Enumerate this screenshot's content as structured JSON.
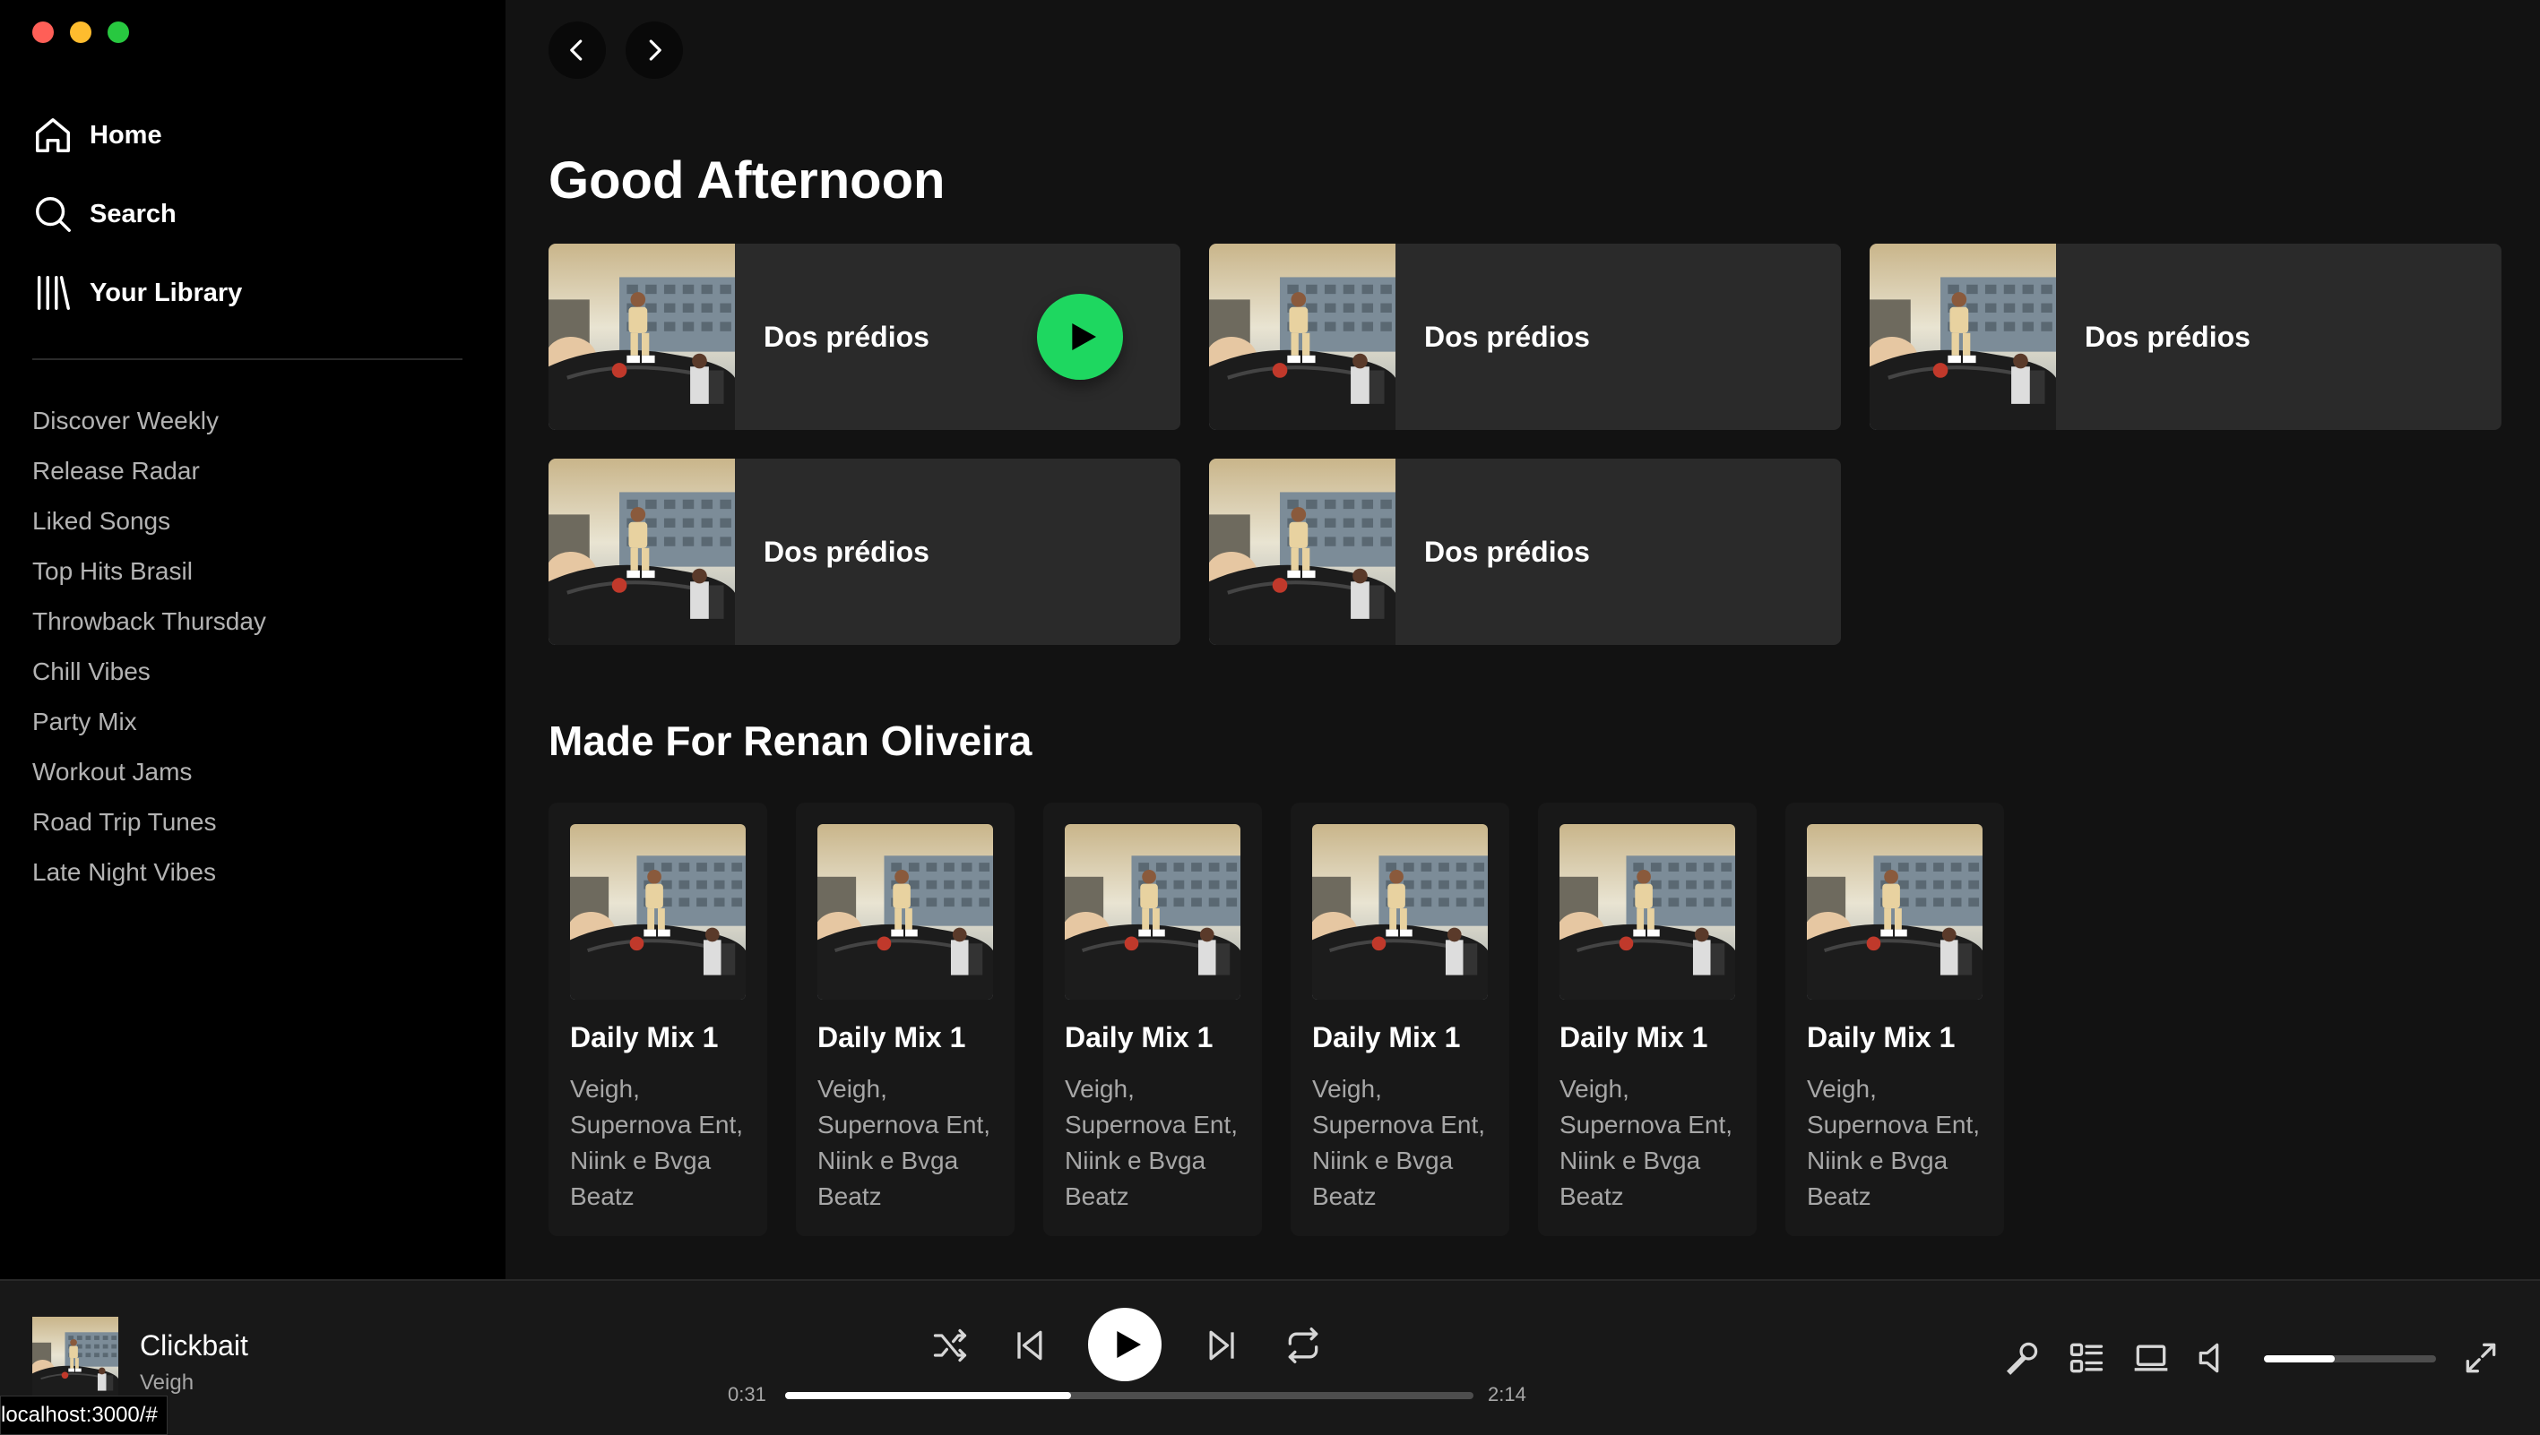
{
  "sidebar": {
    "nav": [
      {
        "label": "Home",
        "icon": "home-icon"
      },
      {
        "label": "Search",
        "icon": "search-icon"
      },
      {
        "label": "Your Library",
        "icon": "library-icon"
      }
    ],
    "playlists": [
      "Discover Weekly",
      "Release Radar",
      "Liked Songs",
      "Top Hits Brasil",
      "Throwback Thursday",
      "Chill Vibes",
      "Party Mix",
      "Workout Jams",
      "Road Trip Tunes",
      "Late Night Vibes"
    ]
  },
  "main": {
    "greeting": "Good Afternoon",
    "shortcuts": [
      {
        "title": "Dos prédios"
      },
      {
        "title": "Dos prédios"
      },
      {
        "title": "Dos prédios"
      },
      {
        "title": "Dos prédios"
      },
      {
        "title": "Dos prédios"
      }
    ],
    "made_for_title": "Made For Renan Oliveira",
    "mixes": [
      {
        "title": "Daily Mix 1",
        "subtitle": "Veigh, Supernova Ent, Niink e Bvga Beatz"
      },
      {
        "title": "Daily Mix 1",
        "subtitle": "Veigh, Supernova Ent, Niink e Bvga Beatz"
      },
      {
        "title": "Daily Mix 1",
        "subtitle": "Veigh, Supernova Ent, Niink e Bvga Beatz"
      },
      {
        "title": "Daily Mix 1",
        "subtitle": "Veigh, Supernova Ent, Niink e Bvga Beatz"
      },
      {
        "title": "Daily Mix 1",
        "subtitle": "Veigh, Supernova Ent, Niink e Bvga Beatz"
      },
      {
        "title": "Daily Mix 1",
        "subtitle": "Veigh, Supernova Ent, Niink e Bvga Beatz"
      }
    ]
  },
  "player": {
    "track": "Clickbait",
    "artist": "Veigh",
    "elapsed": "0:31",
    "duration": "2:14",
    "progress_fraction": 0.415,
    "volume_fraction": 0.41
  },
  "status_url": "localhost:3000/#",
  "colors": {
    "accent": "#1ed760",
    "background": "#121212",
    "sidebar": "#000000",
    "card": "#181818",
    "shortcut": "#2a2a2a"
  }
}
